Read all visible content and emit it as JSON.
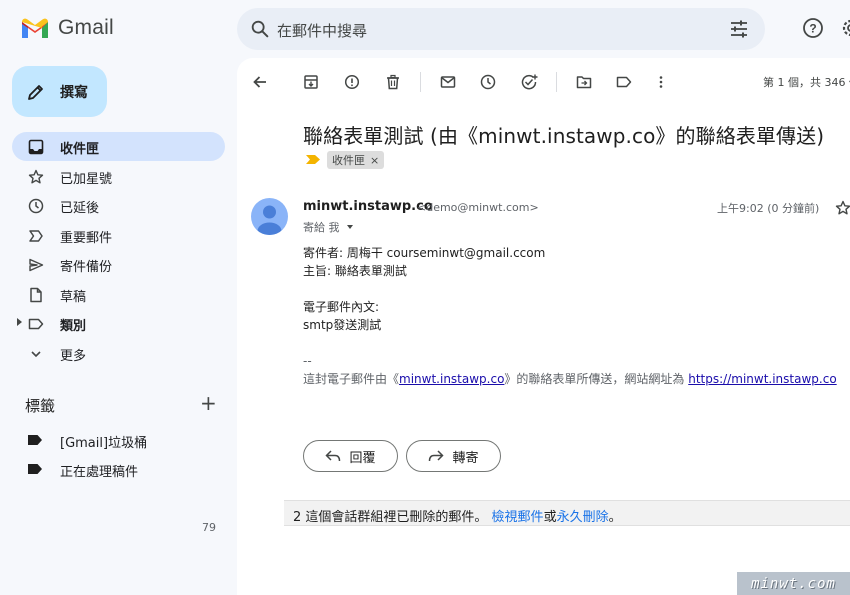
{
  "app": {
    "logo_text": "Gmail",
    "search_placeholder": "在郵件中搜尋"
  },
  "sidebar": {
    "compose_label": "撰寫",
    "items": [
      {
        "label": "收件匣",
        "icon": "inbox-icon",
        "active": true
      },
      {
        "label": "已加星號",
        "icon": "star-icon"
      },
      {
        "label": "已延後",
        "icon": "clock-icon"
      },
      {
        "label": "重要郵件",
        "icon": "important-icon"
      },
      {
        "label": "寄件備份",
        "icon": "send-icon"
      },
      {
        "label": "草稿",
        "icon": "draft-icon"
      },
      {
        "label": "類別",
        "icon": "label-outline-icon",
        "bold": true
      },
      {
        "label": "更多",
        "icon": "chevron-down-icon"
      }
    ],
    "labels_title": "標籤",
    "labels": [
      {
        "label": "[Gmail]垃圾桶"
      },
      {
        "label": "正在處理稿件"
      }
    ],
    "count": "79"
  },
  "toolbar": {
    "icons": [
      "back-icon",
      "archive-icon",
      "report-spam-icon",
      "delete-icon",
      "mark-unread-icon",
      "snooze-icon",
      "add-task-icon",
      "move-to-icon",
      "label-icon",
      "more-vert-icon"
    ],
    "pager": "第 1 個，共 346 個"
  },
  "message": {
    "subject": "聯絡表單測試 (由《minwt.instawp.co》的聯絡表單傳送)",
    "label_chip": "收件匣",
    "label_chip_remove": "×",
    "sender_name": "minwt.instawp.co",
    "sender_email": "<demo@minwt.com>",
    "to_line": "寄給 我",
    "time": "上午9:02 (0 分鐘前)",
    "body": [
      "寄件者: 周梅干 courseminwt@gmail.ccom",
      "主旨: 聯絡表單測試",
      "",
      "電子郵件內文:",
      "smtp發送測試"
    ],
    "signature_dash": "--",
    "signature_prefix": "這封電子郵件由《",
    "signature_link1": "minwt.instawp.co",
    "signature_middle": "》的聯絡表單所傳送，網站網址為 ",
    "signature_link2": "https://minwt.instawp.co",
    "reply_label": "回覆",
    "forward_label": "轉寄"
  },
  "deleted_bar": {
    "prefix": "2 這個會話群組裡已刪除的郵件。 ",
    "view_link": "檢視郵件",
    "or_text": "或",
    "delete_link": "永久刪除",
    "suffix": "。"
  },
  "watermark": "minwt.com",
  "colors": {
    "background": "#f6f8fc",
    "compose_bg": "#c2e7ff",
    "active_nav_bg": "#d3e3fd",
    "search_bg": "#e9eef6",
    "link": "#1a73e8",
    "important_marker": "#f4b400"
  }
}
